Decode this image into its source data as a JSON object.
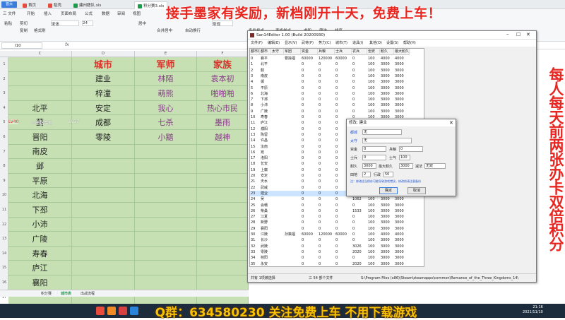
{
  "top_tabs": [
    {
      "label": "首页"
    },
    {
      "label": "稻壳"
    },
    {
      "label": "建州籍队.xls"
    },
    {
      "label": "积分赛3.xls"
    }
  ],
  "home_label": "首页",
  "ribbon_tabs": [
    "三 文件",
    "开始",
    "插入",
    "页面布局",
    "公式",
    "数据",
    "审阅",
    "视图"
  ],
  "ribbon_tools": [
    "粘贴",
    "剪切",
    "复制",
    "格式刷",
    "宋体",
    "24",
    "居中",
    "合并居中",
    "自动换行",
    "常规",
    "条件格式",
    "表格样式",
    "求和",
    "筛选",
    "排序"
  ],
  "formula": {
    "namebox": "I10",
    "fx": "fx"
  },
  "overlay": {
    "top_title": "接手墨家有奖励，新档刚开十天，免费上车！",
    "right_banner": "每人每天前两张办卡双倍积分",
    "qq_bar": "Q群：634580230 关注免费上车 不用下载游戏"
  },
  "spreadsheet": {
    "col_headers": [
      "C",
      "D",
      "E",
      "F"
    ],
    "row_numbers": [
      "1",
      "2",
      "3",
      "4",
      "5",
      "6",
      "7",
      "8",
      "9",
      "10",
      "11",
      "12",
      "13",
      "14",
      "15",
      "16",
      "17"
    ],
    "header_row": {
      "d": "城市",
      "e": "军师",
      "f": "家族"
    },
    "rows": [
      {
        "c": "",
        "d": "建业",
        "e": "林陌",
        "f": "袁本初"
      },
      {
        "c": "",
        "d": "梓潼",
        "e": "萌熊",
        "f": "啪啪啪"
      },
      {
        "c": "北平",
        "d": "安定",
        "e": "我心",
        "f": "热心市民"
      },
      {
        "c": "蓟",
        "d": "成都",
        "e": "七杀",
        "f": "墨雨"
      },
      {
        "c": "晋阳",
        "d": "零陵",
        "e": "小黯",
        "f": "越神"
      },
      {
        "c": "南皮",
        "d": "",
        "e": "",
        "f": ""
      },
      {
        "c": "邺",
        "d": "",
        "e": "",
        "f": ""
      },
      {
        "c": "平原",
        "d": "",
        "e": "",
        "f": ""
      },
      {
        "c": "北海",
        "d": "",
        "e": "",
        "f": ""
      },
      {
        "c": "下邳",
        "d": "",
        "e": "",
        "f": ""
      },
      {
        "c": "小沛",
        "d": "",
        "e": "",
        "f": ""
      },
      {
        "c": "广陵",
        "d": "",
        "e": "",
        "f": ""
      },
      {
        "c": "寿春",
        "d": "",
        "e": "",
        "f": ""
      },
      {
        "c": "庐江",
        "d": "",
        "e": "",
        "f": ""
      },
      {
        "c": "襄阳",
        "d": "",
        "e": "",
        "f": ""
      }
    ],
    "sheet_tabs": [
      "积分赛",
      "城市表",
      "出战流程"
    ]
  },
  "editor": {
    "title": "San14Editor 1.00 (Build 20200930)",
    "menu": [
      "文件(F)",
      "编辑(E)",
      "显示(V)",
      "武将(P)",
      "势力(C)",
      "城市(T)",
      "道具(I)",
      "其他(O)",
      "设置(S)",
      "帮助(H)"
    ],
    "columns": [
      "都市序号",
      "都市",
      "太守",
      "军团",
      "资金",
      "兵粮",
      "士兵",
      "农兵",
      "治安",
      "耐久",
      "最大耐久"
    ],
    "rows": [
      [
        "0",
        "襄平",
        "",
        "曹操福",
        "60000",
        "120000",
        "60000",
        "0",
        "100",
        "4000",
        "4000"
      ],
      [
        "1",
        "北平",
        "",
        "",
        "0",
        "0",
        "0",
        "0",
        "100",
        "3000",
        "3000"
      ],
      [
        "2",
        "蓟",
        "",
        "",
        "0",
        "0",
        "0",
        "0",
        "100",
        "3000",
        "3000"
      ],
      [
        "3",
        "南皮",
        "",
        "",
        "0",
        "0",
        "0",
        "0",
        "100",
        "3000",
        "3000"
      ],
      [
        "4",
        "邺",
        "",
        "",
        "0",
        "0",
        "0",
        "0",
        "100",
        "3000",
        "3000"
      ],
      [
        "5",
        "平原",
        "",
        "",
        "0",
        "0",
        "0",
        "0",
        "100",
        "3000",
        "3000"
      ],
      [
        "6",
        "北海",
        "",
        "",
        "0",
        "0",
        "0",
        "0",
        "100",
        "3000",
        "3000"
      ],
      [
        "7",
        "下邳",
        "",
        "",
        "0",
        "0",
        "0",
        "0",
        "100",
        "3000",
        "3000"
      ],
      [
        "8",
        "小沛",
        "",
        "",
        "0",
        "0",
        "0",
        "0",
        "100",
        "3000",
        "3000"
      ],
      [
        "9",
        "广陵",
        "",
        "",
        "0",
        "0",
        "0",
        "0",
        "100",
        "3000",
        "3000"
      ],
      [
        "10",
        "寿春",
        "",
        "",
        "0",
        "0",
        "0",
        "0",
        "100",
        "3000",
        "3000"
      ],
      [
        "11",
        "庐江",
        "",
        "",
        "0",
        "0",
        "0",
        "0",
        "100",
        "3000",
        "3000"
      ],
      [
        "12",
        "濮阳",
        "",
        "",
        "0",
        "0",
        "0",
        "0",
        "100",
        "3000",
        "3000"
      ],
      [
        "13",
        "陈留",
        "",
        "",
        "0",
        "0",
        "0",
        "0",
        "100",
        "3000",
        "3000"
      ],
      [
        "14",
        "许昌",
        "",
        "",
        "0",
        "0",
        "0",
        "0",
        "100",
        "3000",
        "3000"
      ],
      [
        "15",
        "汝南",
        "",
        "",
        "0",
        "0",
        "0",
        "0",
        "100",
        "3000",
        "3000"
      ],
      [
        "16",
        "宛",
        "",
        "",
        "0",
        "0",
        "0",
        "0",
        "100",
        "3000",
        "3000"
      ],
      [
        "17",
        "洛阳",
        "",
        "",
        "0",
        "0",
        "0",
        "0",
        "100",
        "3000",
        "3000"
      ],
      [
        "18",
        "长安",
        "",
        "",
        "0",
        "0",
        "0",
        "0",
        "100",
        "3000",
        "3000"
      ],
      [
        "19",
        "上庸",
        "",
        "",
        "0",
        "0",
        "0",
        "0",
        "100",
        "3000",
        "3000"
      ],
      [
        "20",
        "安定",
        "",
        "",
        "0",
        "0",
        "0",
        "0",
        "100",
        "3000",
        "3000"
      ],
      [
        "21",
        "天水",
        "",
        "",
        "0",
        "0",
        "0",
        "0",
        "100",
        "3000",
        "3000"
      ],
      [
        "22",
        "武威",
        "",
        "",
        "0",
        "0",
        "0",
        "0",
        "100",
        "3000",
        "3000"
      ],
      [
        "23",
        "建业",
        "",
        "",
        "0",
        "0",
        "0",
        "0",
        "100",
        "3000",
        "3000"
      ],
      [
        "24",
        "吴",
        "",
        "",
        "0",
        "0",
        "0",
        "1062",
        "100",
        "3000",
        "3000"
      ],
      [
        "25",
        "会稽",
        "",
        "",
        "0",
        "0",
        "0",
        "0",
        "100",
        "3000",
        "3000"
      ],
      [
        "26",
        "柴桑",
        "",
        "",
        "0",
        "0",
        "0",
        "1533",
        "100",
        "3000",
        "3000"
      ],
      [
        "27",
        "江夏",
        "",
        "",
        "0",
        "0",
        "0",
        "0",
        "100",
        "3000",
        "3000"
      ],
      [
        "28",
        "新野",
        "",
        "",
        "0",
        "0",
        "0",
        "0",
        "100",
        "3000",
        "3000"
      ],
      [
        "29",
        "襄阳",
        "",
        "",
        "0",
        "0",
        "0",
        "0",
        "100",
        "3000",
        "3000"
      ],
      [
        "30",
        "江陵",
        "",
        "孙策福",
        "60000",
        "120000",
        "60000",
        "0",
        "100",
        "4000",
        "4000"
      ],
      [
        "31",
        "长沙",
        "",
        "",
        "0",
        "0",
        "0",
        "0",
        "100",
        "3000",
        "3000"
      ],
      [
        "32",
        "武陵",
        "",
        "",
        "0",
        "0",
        "0",
        "3026",
        "100",
        "3000",
        "3000"
      ],
      [
        "33",
        "零陵",
        "",
        "",
        "0",
        "0",
        "0",
        "2020",
        "100",
        "3000",
        "3000"
      ],
      [
        "34",
        "桂阳",
        "",
        "",
        "0",
        "0",
        "0",
        "0",
        "100",
        "3000",
        "3000"
      ],
      [
        "35",
        "永安",
        "",
        "",
        "0",
        "0",
        "0",
        "2020",
        "100",
        "3000",
        "3000"
      ]
    ],
    "status": [
      "共有 1项被选择",
      "三 54 部个文件",
      "S:\\Program Files (x86)\\Steam\\steamapps\\common\\Romance_of_the_Three_Kingdoms_14\\"
    ]
  },
  "dialog": {
    "title": "修改: 建业",
    "labels": {
      "city": "都城",
      "governor": "太守",
      "funds": "资金",
      "food": "兵粮",
      "soldiers": "士兵",
      "morale": "士气",
      "durability": "耐久",
      "max_durability": "最大耐久",
      "garrison": "减法",
      "order": "治安",
      "troops": "田地",
      "turns": "行政"
    },
    "values": {
      "city": "无",
      "governor": "无",
      "funds": "0",
      "food": "0",
      "soldiers": "0",
      "morale": "100",
      "durability": "3000",
      "max_durability": "3000",
      "garrison": "无效",
      "order": "100",
      "troops": "2",
      "turns": "50"
    },
    "note": "注：修改适当保存可能导致游戏错误，修改前请注意备份",
    "ok": "确定",
    "cancel": "取消"
  },
  "player_tags": [
    "LV40",
    "小熊吃手指",
    "LV37"
  ],
  "clock": {
    "time": "21:16",
    "date": "2021/11/10"
  },
  "colors": {
    "accent_red": "#e8251f",
    "cell_green": "#c6e0b4",
    "qq_yellow": "#f5c100"
  }
}
